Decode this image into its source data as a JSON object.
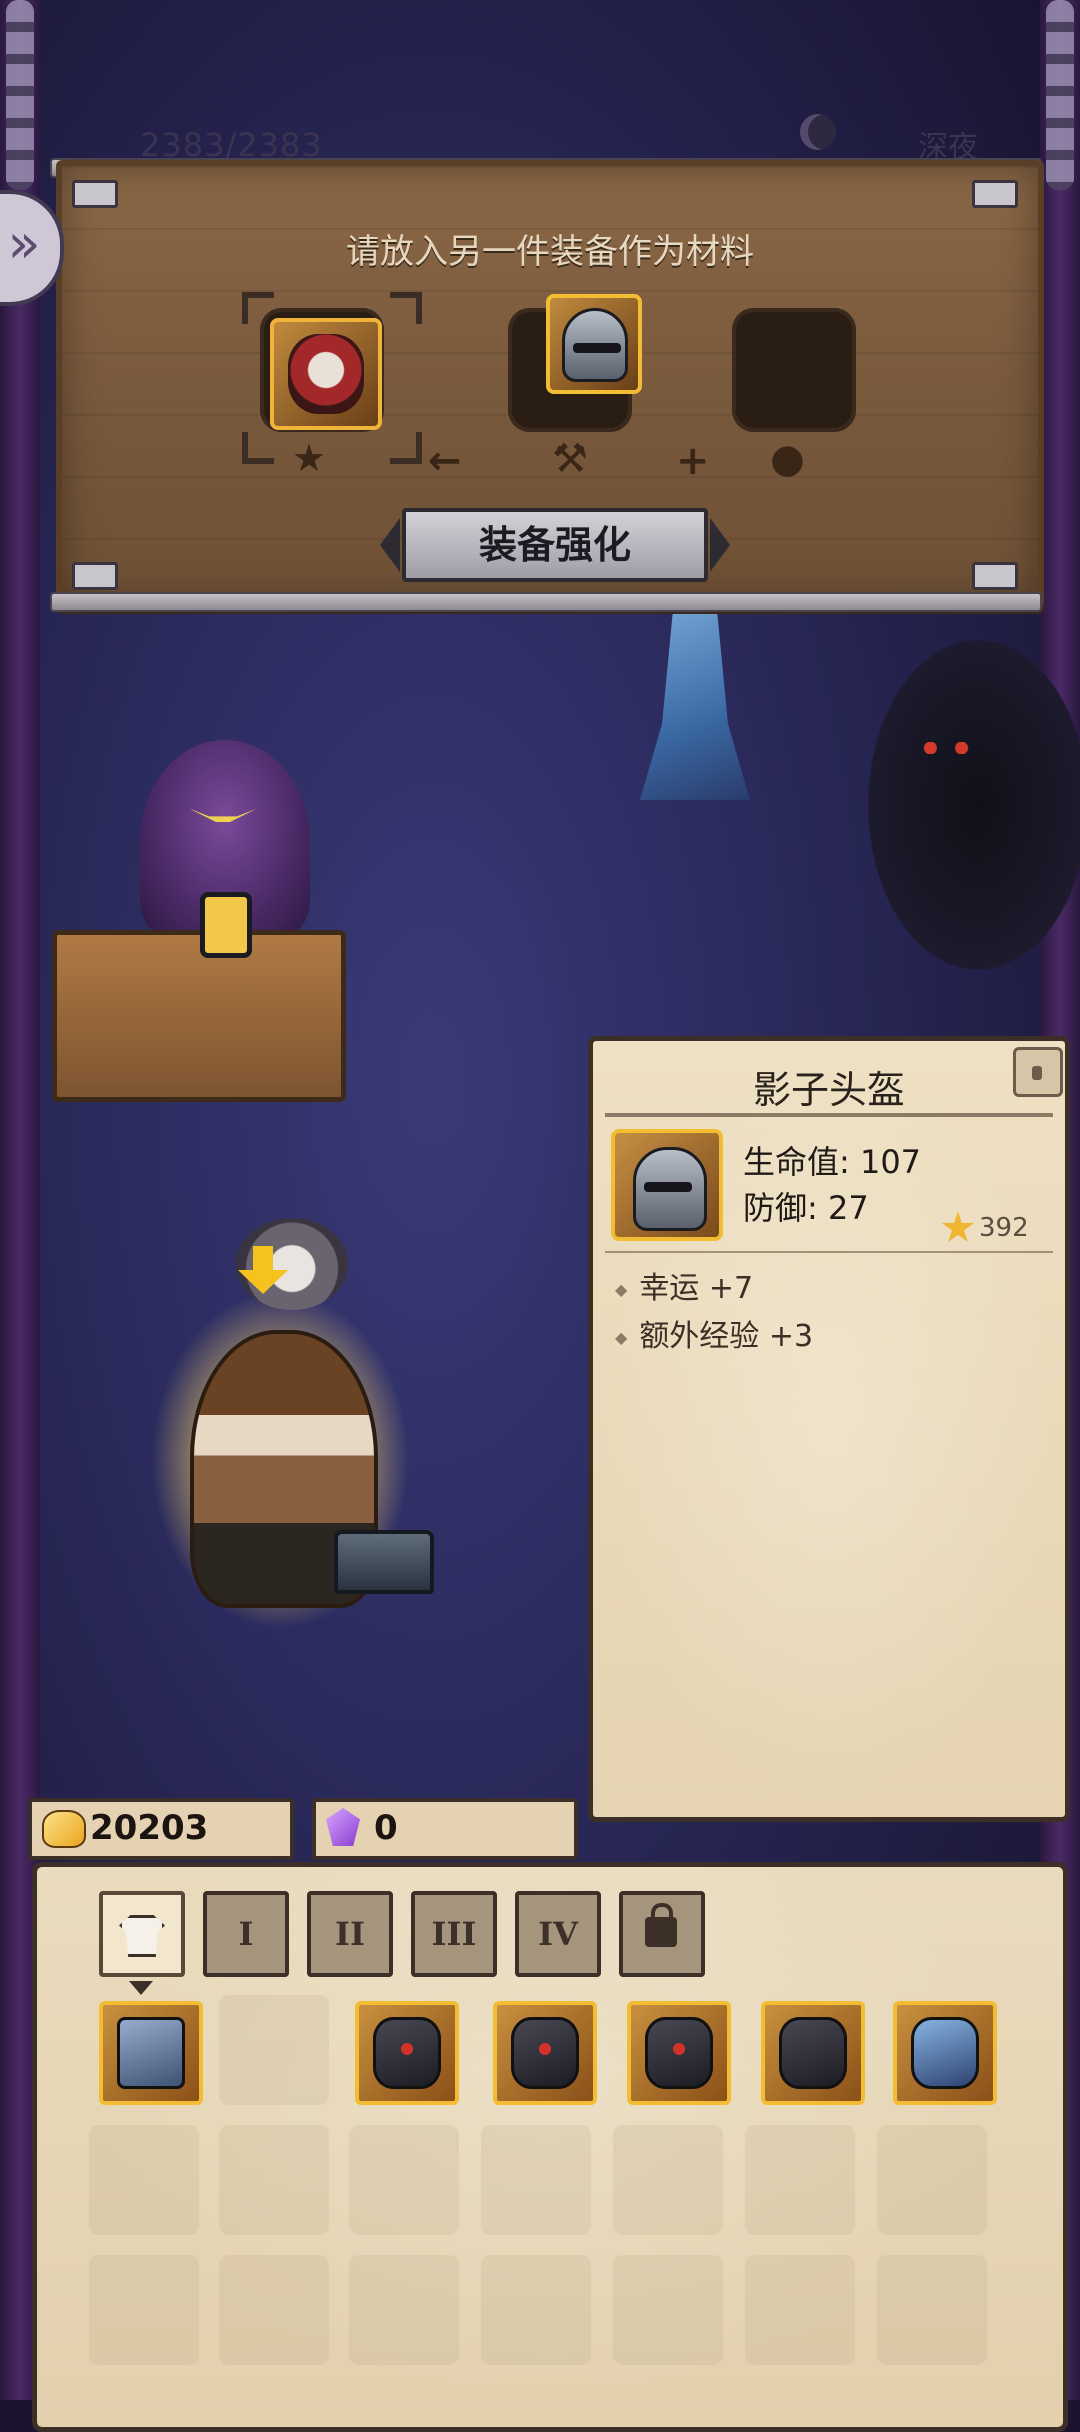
{
  "top_bar": {
    "hp": "2383/2383",
    "right_label": "深夜"
  },
  "forge": {
    "instruction": "请放入另一件装备作为材料",
    "enhance_button": "装备强化",
    "side_arrow": "»",
    "operators": [
      "←",
      "+"
    ],
    "slots": [
      {
        "name": "result-slot",
        "icon": "bunny-armor-icon"
      },
      {
        "name": "base-slot",
        "icon": "shadow-helmet-icon"
      },
      {
        "name": "material-slot",
        "icon": ""
      }
    ]
  },
  "item_card": {
    "name": "影子头盔",
    "stats": [
      "生命值: 107",
      "防御: 27"
    ],
    "star_value": "392",
    "bonuses": [
      "幸运 +7",
      "额外经验 +3"
    ],
    "icon": "shadow-helmet-icon"
  },
  "currency": {
    "gold": "20203",
    "gems": "0"
  },
  "inventory": {
    "tabs": [
      "",
      "I",
      "II",
      "III",
      "IV",
      ""
    ],
    "tab_icons": [
      "shirt-icon",
      "",
      "",
      "",
      "",
      "padlock-icon"
    ],
    "items": [
      {
        "name": "hammer-item",
        "icon": "warhammer-icon"
      },
      {
        "name": "empty-slot",
        "icon": ""
      },
      {
        "name": "dark-armor-item",
        "icon": "dark-armor-icon"
      },
      {
        "name": "dark-helmet-item",
        "icon": "dark-helmet-icon"
      },
      {
        "name": "spiked-armor-item",
        "icon": "spiked-armor-icon"
      },
      {
        "name": "gauntlet-item",
        "icon": "gauntlet-icon"
      },
      {
        "name": "blue-helmet-item",
        "icon": "blue-helmet-icon"
      }
    ]
  },
  "colors": {
    "accent_gold": "#f3bd33",
    "parchment": "#e9dbbd",
    "wood": "#7a5a3d"
  }
}
